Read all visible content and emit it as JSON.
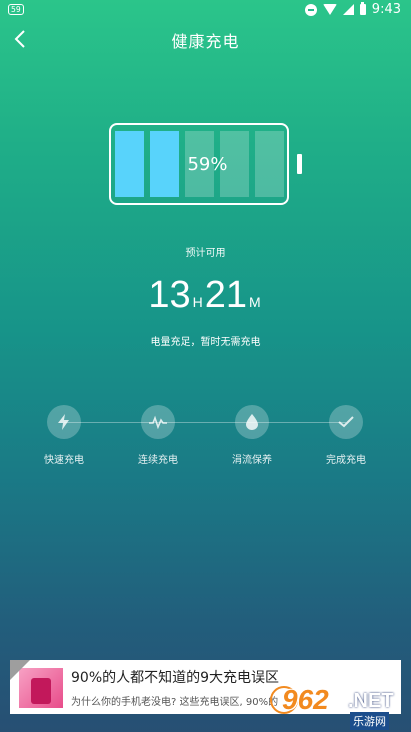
{
  "status_bar": {
    "badge": "59",
    "time": "9:43",
    "icons": [
      "dnd-icon",
      "wifi-icon",
      "signal-icon",
      "battery-icon"
    ]
  },
  "header": {
    "title": "健康充电",
    "back_icon": "chevron-left-icon"
  },
  "battery": {
    "percent_text": "59%",
    "level": 0.59,
    "cells_total": 5,
    "cells_filled": 2,
    "fill_color": "#58d3fb"
  },
  "estimate": {
    "label": "预计可用",
    "hours": "13",
    "hours_unit": "H",
    "minutes": "21",
    "minutes_unit": "M",
    "status": "电量充足，暂时无需充电"
  },
  "stages": [
    {
      "label": "快速充电",
      "icon": "lightning-icon"
    },
    {
      "label": "连续充电",
      "icon": "pulse-icon"
    },
    {
      "label": "涓流保养",
      "icon": "droplet-icon"
    },
    {
      "label": "完成充电",
      "icon": "check-icon"
    }
  ],
  "ad": {
    "title": "90%的人都不知道的9大充电误区",
    "description": "为什么你的手机老没电? 这些充电误区, 90%的"
  },
  "watermark": {
    "number": "962",
    "suffix": ".NET",
    "sub": "乐游网"
  },
  "colors": {
    "gradient_top": "#2bc58a",
    "gradient_bottom": "#274f73",
    "accent": "#58d3fb"
  }
}
